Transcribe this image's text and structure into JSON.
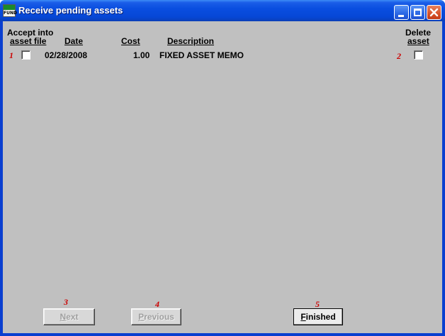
{
  "window": {
    "title": "Receive pending assets",
    "app_icon_text": "FUND"
  },
  "columns": {
    "accept_line1": "Accept into",
    "accept_line2": "asset file",
    "date": "Date",
    "cost": "Cost",
    "description": "Description",
    "delete_line1": "Delete",
    "delete_line2": "asset"
  },
  "rows": [
    {
      "date": "02/28/2008",
      "cost": "1.00",
      "description": "FIXED ASSET MEMO",
      "accept_checked": false,
      "delete_checked": false
    }
  ],
  "annotations": {
    "n1": "1",
    "n2": "2",
    "n3": "3",
    "n4": "4",
    "n5": "5"
  },
  "buttons": {
    "next": {
      "label_prefix": "",
      "label_mnemonic": "N",
      "label_rest": "ext",
      "enabled": false
    },
    "previous": {
      "label_prefix": "",
      "label_mnemonic": "P",
      "label_rest": "revious",
      "enabled": false
    },
    "finished": {
      "label_prefix": "",
      "label_mnemonic": "F",
      "label_rest": "inished",
      "enabled": true
    }
  },
  "colors": {
    "titlebar": "#0a4ee0",
    "client_bg": "#c0c0c0",
    "annotation": "#cc0000"
  }
}
